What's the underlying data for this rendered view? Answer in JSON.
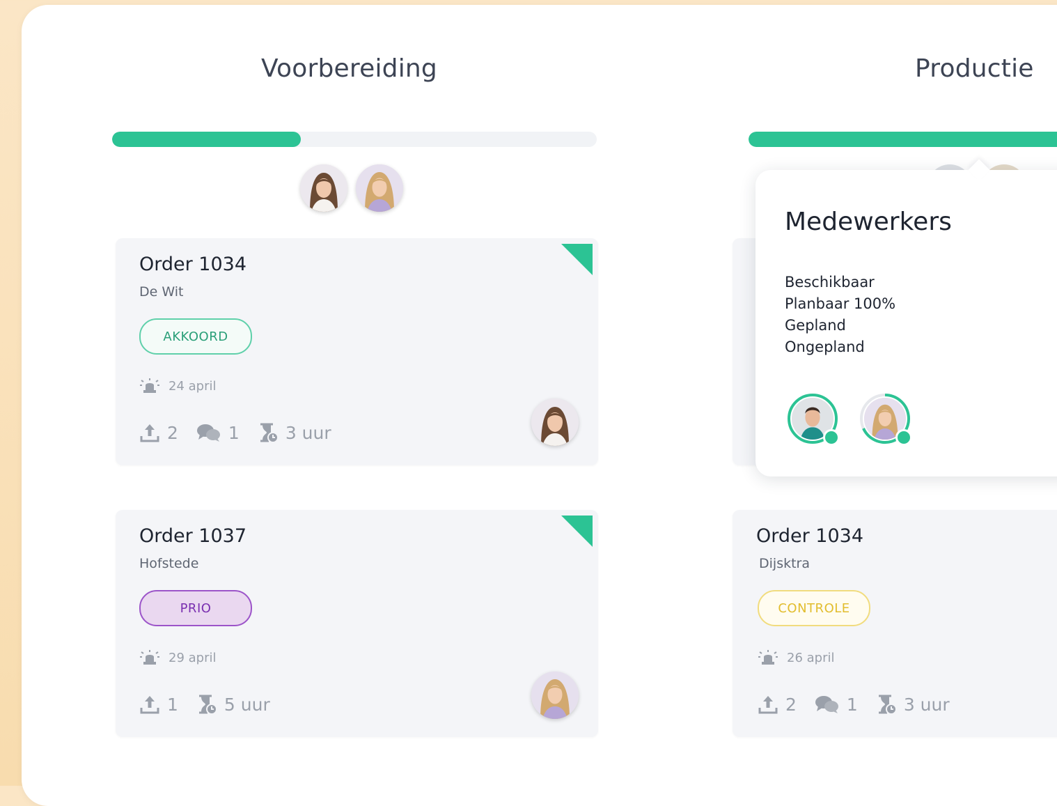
{
  "columns": [
    {
      "title": "Voorbereiding",
      "progress": 0.39,
      "cards": [
        {
          "order": "Order 1034",
          "customer": "De Wit",
          "badge": "AKKOORD",
          "date": "24 april",
          "uploads": "2",
          "comments": "1",
          "hours": "3 uur"
        },
        {
          "order": "Order 1037",
          "customer": "Hofstede",
          "badge": "PRIO",
          "date": "29 april",
          "uploads": "1",
          "hours": "5 uur"
        }
      ]
    },
    {
      "title": "Productie",
      "progress": 1.0,
      "cards": [
        {
          "order": "Order 1034",
          "customer": "Dijsktra",
          "badge": "CONTROLE",
          "date": "26 april",
          "uploads": "2",
          "comments": "1",
          "hours": "3 uur"
        }
      ]
    }
  ],
  "popover": {
    "title": "Medewerkers",
    "items": [
      "Beschikbaar",
      "Planbaar 100%",
      "Gepland",
      "Ongepland"
    ]
  },
  "colors": {
    "accent": "#2cc394",
    "badge_green": "#2a9f78",
    "badge_purple": "#7a2fb0",
    "badge_yellow": "#e2bd2e"
  },
  "icons": [
    "upload-icon",
    "comments-icon",
    "hourglass-icon",
    "alarm-icon",
    "corner-flag-icon"
  ]
}
